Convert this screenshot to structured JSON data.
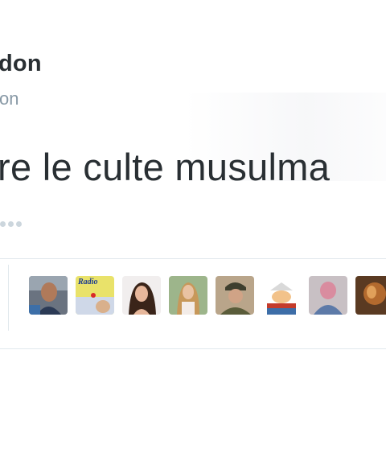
{
  "tweet": {
    "author_name": "don",
    "author_handle": "on",
    "text": "re le culte musulma"
  },
  "favoriters": [
    {
      "name": "avatar-1"
    },
    {
      "name": "avatar-2",
      "label": "Radio"
    },
    {
      "name": "avatar-3"
    },
    {
      "name": "avatar-4"
    },
    {
      "name": "avatar-5"
    },
    {
      "name": "avatar-6"
    },
    {
      "name": "avatar-7"
    },
    {
      "name": "avatar-8"
    }
  ],
  "colors": {
    "text": "#292f33",
    "secondary": "#8899a6",
    "divider": "#e1e8ed"
  }
}
